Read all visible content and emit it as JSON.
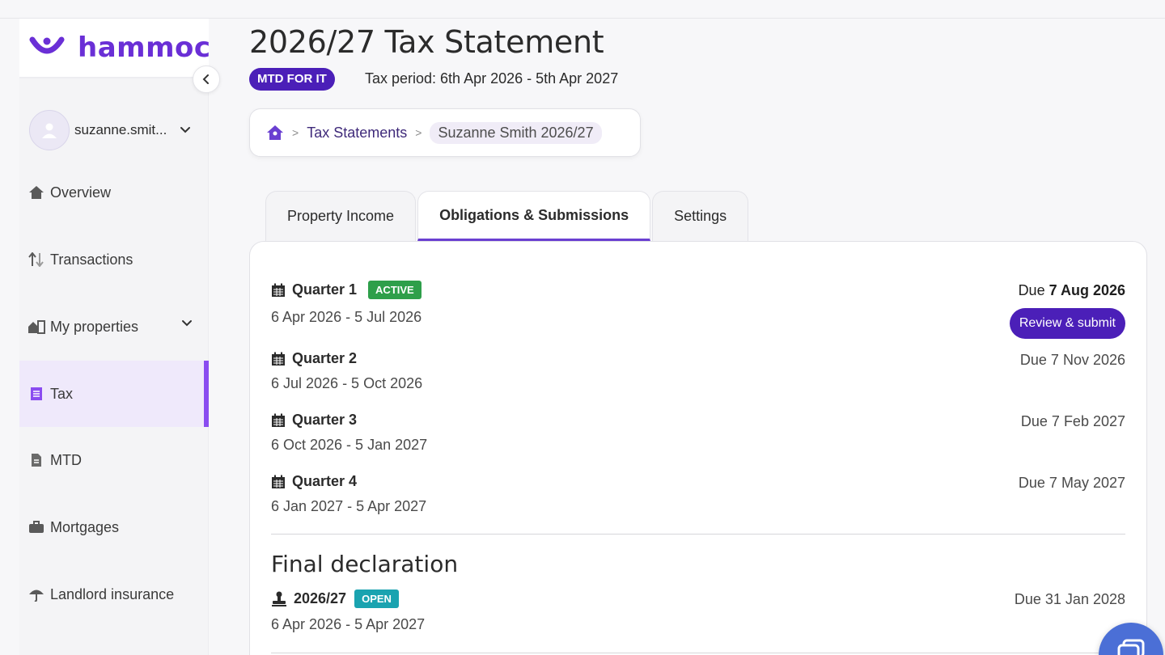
{
  "brand": {
    "name": "hammock",
    "color": "#6a2fd6"
  },
  "user": {
    "name": "suzanne.smit..."
  },
  "nav": {
    "items": [
      {
        "label": "Overview",
        "icon": "home-icon"
      },
      {
        "label": "Transactions",
        "icon": "sort-arrows-icon"
      },
      {
        "label": "My properties",
        "icon": "properties-icon"
      },
      {
        "label": "Tax",
        "icon": "document-icon",
        "active": true
      },
      {
        "label": "MTD",
        "icon": "file-icon"
      },
      {
        "label": "Mortgages",
        "icon": "briefcase-icon"
      },
      {
        "label": "Landlord insurance",
        "icon": "umbrella-icon"
      }
    ]
  },
  "header": {
    "title": "2026/27 Tax Statement",
    "badge": "MTD FOR IT",
    "tax_period": "Tax period: 6th Apr 2026 - 5th Apr 2027"
  },
  "breadcrumb": {
    "home_icon": "home-icon",
    "items": [
      "Tax Statements",
      "Suzanne Smith 2026/27"
    ],
    "separator": ">"
  },
  "tabs": [
    {
      "label": "Property Income"
    },
    {
      "label": "Obligations & Submissions",
      "active": true
    },
    {
      "label": "Settings"
    }
  ],
  "quarters": [
    {
      "title": "Quarter 1",
      "status": "ACTIVE",
      "dates": "6 Apr 2026 - 5 Jul 2026",
      "due_prefix": "Due",
      "due_date": "7 Aug 2026",
      "action": "Review & submit"
    },
    {
      "title": "Quarter 2",
      "dates": "6 Jul 2026 - 5 Oct 2026",
      "due": "Due 7 Nov 2026"
    },
    {
      "title": "Quarter 3",
      "dates": "6 Oct 2026 - 5 Jan 2027",
      "due": "Due 7 Feb 2027"
    },
    {
      "title": "Quarter 4",
      "dates": "6 Jan 2027 - 5 Apr 2027",
      "due": "Due 7 May 2027"
    }
  ],
  "final": {
    "section_title": "Final declaration",
    "title": "2026/27",
    "status": "OPEN",
    "dates": "6 Apr 2026 - 5 Apr 2027",
    "due": "Due 31 Jan 2028"
  },
  "colors": {
    "accent": "#4b1fb8",
    "active_badge": "#2e9f4a",
    "open_badge": "#1aa3b0",
    "nav_active_bar": "#8a4cf0"
  }
}
